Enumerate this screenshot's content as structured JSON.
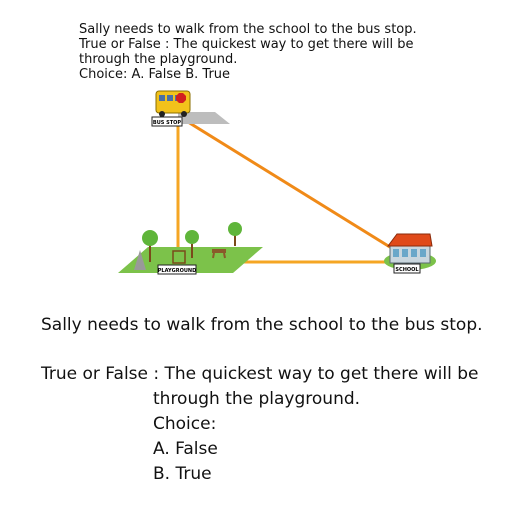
{
  "image_text": {
    "line1": "Sally needs to walk from the school to the bus stop.",
    "line2": "True or False : The quickest way to get there will be",
    "line3": "through the playground.",
    "line4": "Choice: A. False   B. True"
  },
  "diagram": {
    "bus_stop_label": "BUS STOP",
    "playground_label": "PLAYGROUND",
    "school_label": "SCHOOL"
  },
  "question": {
    "intro": "Sally needs to walk from the school to the bus stop.",
    "line1": "True or False : The quickest way to get there will be",
    "line2": "through the playground.",
    "choice_label": "Choice:",
    "option_a": "A. False",
    "option_b": "B. True"
  },
  "colors": {
    "path": "#f5a623",
    "grass": "#7cc24a",
    "school_roof": "#e04a1a"
  }
}
